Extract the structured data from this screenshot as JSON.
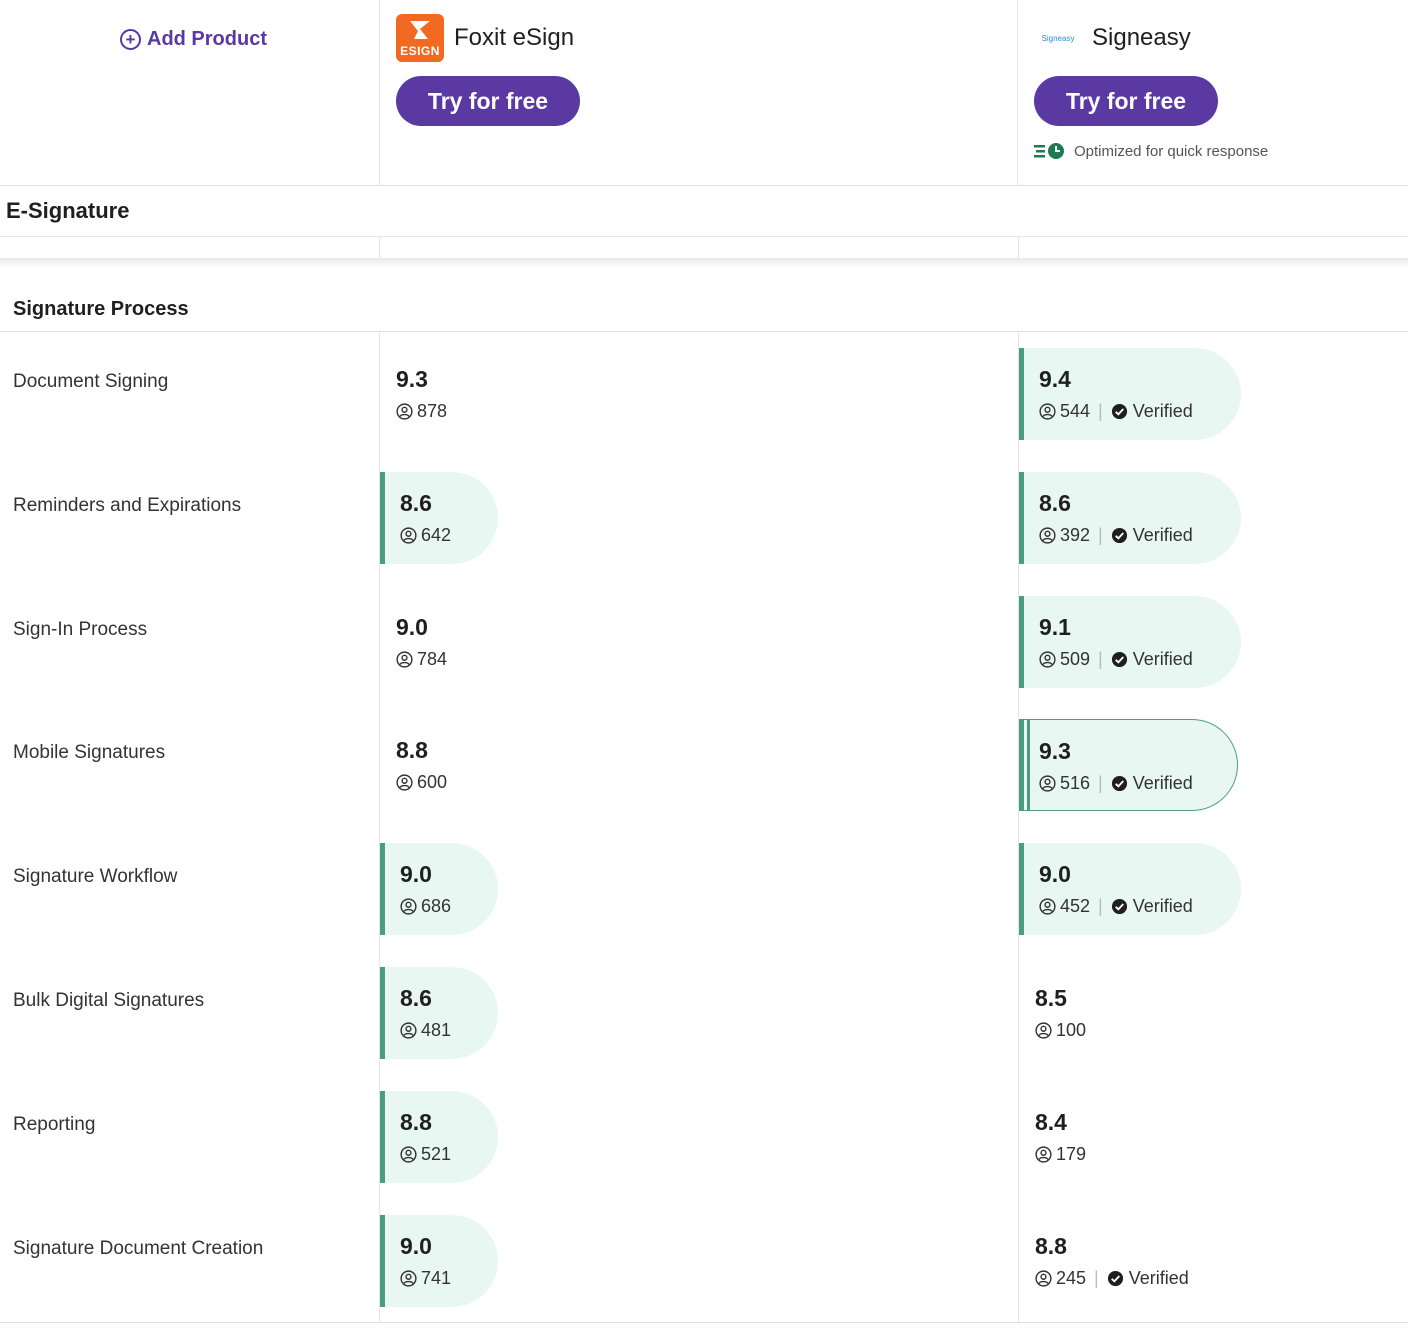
{
  "header": {
    "add_product": "Add Product",
    "products": [
      {
        "name": "Foxit eSign",
        "logo_text": "ESIGN",
        "cta": "Try for free"
      },
      {
        "name": "Signeasy",
        "logo_text": "Signeasy",
        "cta": "Try for free",
        "badge": "Optimized for quick response"
      }
    ]
  },
  "category": "E-Signature",
  "section": "Signature Process",
  "verified_label": "Verified",
  "colors": {
    "accent": "#5a39a2",
    "highlight_bg": "#e8f7f2",
    "highlight_border": "#4a9e7e",
    "foxit": "#f26a21"
  },
  "features": [
    {
      "label": "Document Signing",
      "foxit": {
        "score": "9.3",
        "reviews": "878"
      },
      "signeasy": {
        "score": "9.4",
        "reviews": "544"
      }
    },
    {
      "label": "Reminders and Expirations",
      "foxit": {
        "score": "8.6",
        "reviews": "642"
      },
      "signeasy": {
        "score": "8.6",
        "reviews": "392"
      }
    },
    {
      "label": "Sign-In Process",
      "foxit": {
        "score": "9.0",
        "reviews": "784"
      },
      "signeasy": {
        "score": "9.1",
        "reviews": "509"
      }
    },
    {
      "label": "Mobile Signatures",
      "foxit": {
        "score": "8.8",
        "reviews": "600"
      },
      "signeasy": {
        "score": "9.3",
        "reviews": "516"
      }
    },
    {
      "label": "Signature Workflow",
      "foxit": {
        "score": "9.0",
        "reviews": "686"
      },
      "signeasy": {
        "score": "9.0",
        "reviews": "452"
      }
    },
    {
      "label": "Bulk Digital Signatures",
      "foxit": {
        "score": "8.6",
        "reviews": "481"
      },
      "signeasy": {
        "score": "8.5",
        "reviews": "100"
      }
    },
    {
      "label": "Reporting",
      "foxit": {
        "score": "8.8",
        "reviews": "521"
      },
      "signeasy": {
        "score": "8.4",
        "reviews": "179"
      }
    },
    {
      "label": "Signature Document Creation",
      "foxit": {
        "score": "9.0",
        "reviews": "741"
      },
      "signeasy": {
        "score": "8.8",
        "reviews": "245"
      }
    }
  ]
}
